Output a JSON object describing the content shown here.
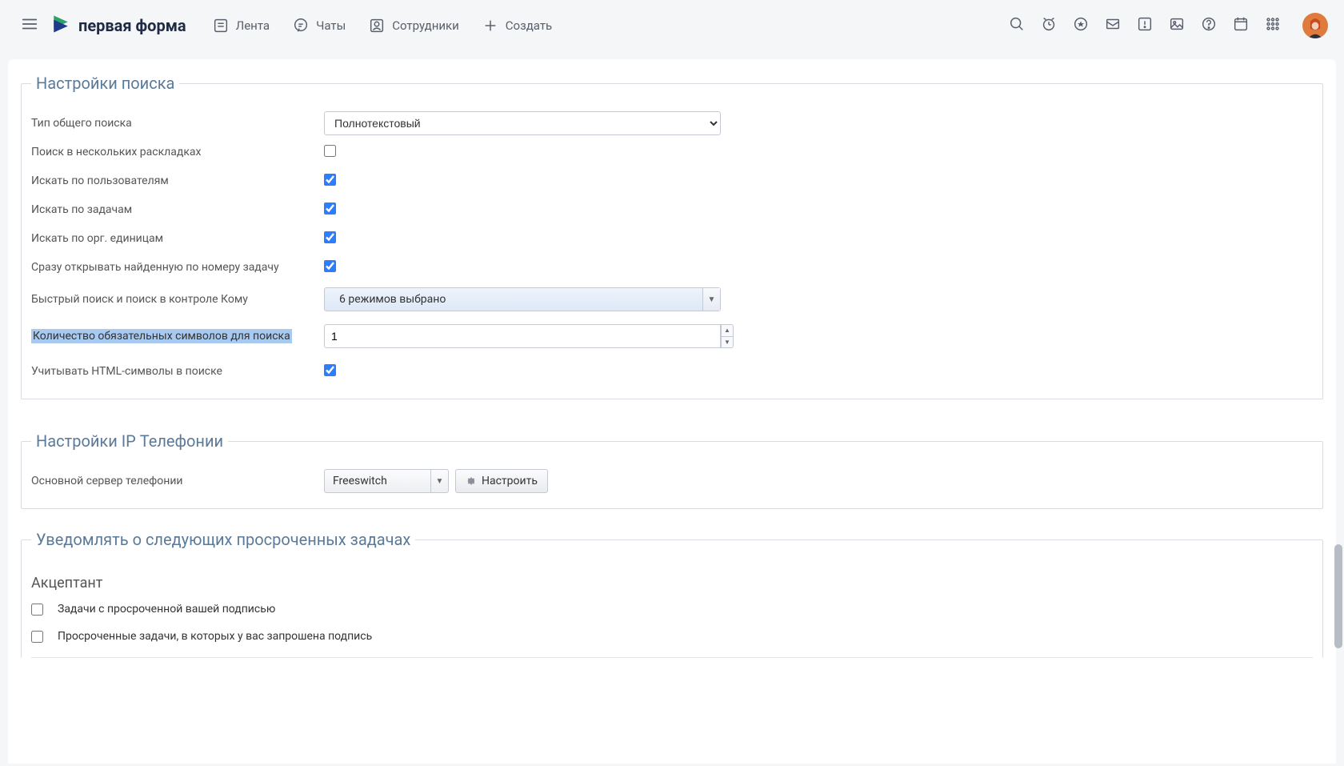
{
  "header": {
    "logo_text": "первая форма",
    "nav": {
      "feed": "Лента",
      "chats": "Чаты",
      "people": "Сотрудники",
      "create": "Создать"
    }
  },
  "search_settings": {
    "legend": "Настройки поиска",
    "type_label": "Тип общего поиска",
    "type_value": "Полнотекстовый",
    "multi_layout_label": "Поиск в нескольких раскладках",
    "multi_layout_checked": false,
    "by_users_label": "Искать по пользователям",
    "by_users_checked": true,
    "by_tasks_label": "Искать по задачам",
    "by_tasks_checked": true,
    "by_orgunits_label": "Искать по орг. единицам",
    "by_orgunits_checked": true,
    "open_by_number_label": "Сразу открывать найденную по номеру задачу",
    "open_by_number_checked": true,
    "quick_search_label": "Быстрый поиск и поиск в контроле Кому",
    "quick_search_value": "6 режимов выбрано",
    "min_chars_label": "Количество обязательных символов для поиска",
    "min_chars_value": "1",
    "html_symbols_label": "Учитывать HTML-символы в поиске",
    "html_symbols_checked": true
  },
  "telephony": {
    "legend": "Настройки IP Телефонии",
    "server_label": "Основной сервер телефонии",
    "server_value": "Freeswitch",
    "configure_btn": "Настроить"
  },
  "overdue": {
    "legend": "Уведомлять о следующих просроченных задачах",
    "acceptor_heading": "Акцептант",
    "row1": "Задачи с просроченной вашей подписью",
    "row1_checked": false,
    "row2": "Просроченные задачи, в которых у вас запрошена подпись",
    "row2_checked": false
  }
}
